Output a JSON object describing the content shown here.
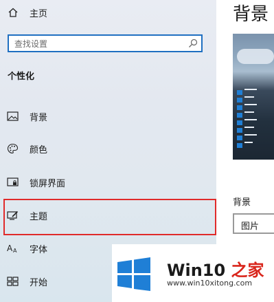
{
  "sidebar": {
    "home_label": "主页",
    "search": {
      "placeholder": "查找设置"
    },
    "section_title": "个性化",
    "items": [
      {
        "label": "背景",
        "icon": "picture-icon"
      },
      {
        "label": "颜色",
        "icon": "palette-icon"
      },
      {
        "label": "锁屏界面",
        "icon": "lock-screen-icon"
      },
      {
        "label": "主题",
        "icon": "theme-icon",
        "selected": true,
        "highlighted": true
      },
      {
        "label": "字体",
        "icon": "font-icon"
      },
      {
        "label": "开始",
        "icon": "start-icon"
      }
    ]
  },
  "main": {
    "title": "背景",
    "background_label": "背景",
    "background_select": "图片"
  },
  "watermark": {
    "brand": "Win10 之家",
    "url": "www.win10xitong.com"
  },
  "colors": {
    "accent": "#0b5fb3",
    "highlight_border": "#e02a2a",
    "windows_logo": "#1f7fd6",
    "brand_red": "#d9261c"
  }
}
